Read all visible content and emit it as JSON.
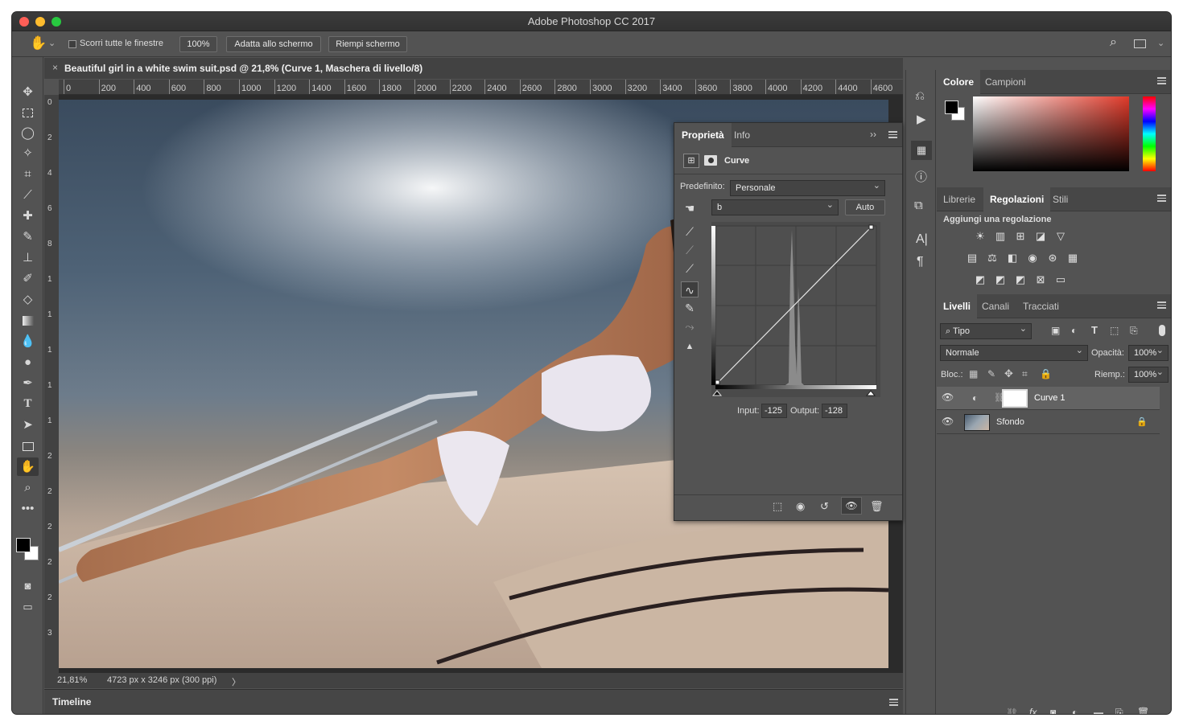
{
  "window": {
    "title": "Adobe Photoshop CC 2017"
  },
  "options_bar": {
    "scroll_all_label": "Scorri tutte le finestre",
    "zoom_label": "100%",
    "fit_screen_label": "Adatta allo schermo",
    "fill_screen_label": "Riempi schermo"
  },
  "document": {
    "tab_title": "Beautiful girl in a white swim suit.psd @ 21,8% (Curve 1, Maschera di livello/8)",
    "ruler_h": [
      "0",
      "200",
      "400",
      "600",
      "800",
      "1000",
      "1200",
      "1400",
      "1600",
      "1800",
      "2000",
      "2200",
      "2400",
      "2600",
      "2800",
      "3000",
      "3200",
      "3400",
      "3600",
      "3800",
      "4000",
      "4200",
      "4400",
      "4600"
    ],
    "ruler_v": [
      "0",
      "2",
      "4",
      "6",
      "8",
      "1",
      "1",
      "1",
      "1",
      "1",
      "2",
      "2",
      "2",
      "2",
      "2",
      "3"
    ]
  },
  "status": {
    "zoom": "21,81%",
    "doc_info": "4723 px x 3246 px (300 ppi)",
    "arrow": "〉"
  },
  "timeline": {
    "label": "Timeline"
  },
  "properties": {
    "tab_props": "Proprietà",
    "tab_info": "Info",
    "expand": "››",
    "title": "Curve",
    "preset_label": "Predefinito:",
    "preset_value": "Personale",
    "channel_value": "b",
    "auto_label": "Auto",
    "input_label": "Input:",
    "input_value": "-125",
    "output_label": "Output:",
    "output_value": "-128"
  },
  "color_panel": {
    "tab_color": "Colore",
    "tab_swatches": "Campioni"
  },
  "adjust_panel": {
    "tab_libraries": "Librerie",
    "tab_adjustments": "Regolazioni",
    "tab_styles": "Stili",
    "heading": "Aggiungi una regolazione"
  },
  "layers_panel": {
    "tab_layers": "Livelli",
    "tab_channels": "Canali",
    "tab_paths": "Tracciati",
    "kind_label": "Tipo",
    "blend_mode": "Normale",
    "opacity_label": "Opacità:",
    "opacity_value": "100%",
    "lock_label": "Bloc.:",
    "fill_label": "Riemp.:",
    "fill_value": "100%",
    "layers": [
      {
        "name": "Curve 1"
      },
      {
        "name": "Sfondo"
      }
    ]
  },
  "colors": {
    "accent": "#ff5f57",
    "ui_bg": "#535353"
  }
}
